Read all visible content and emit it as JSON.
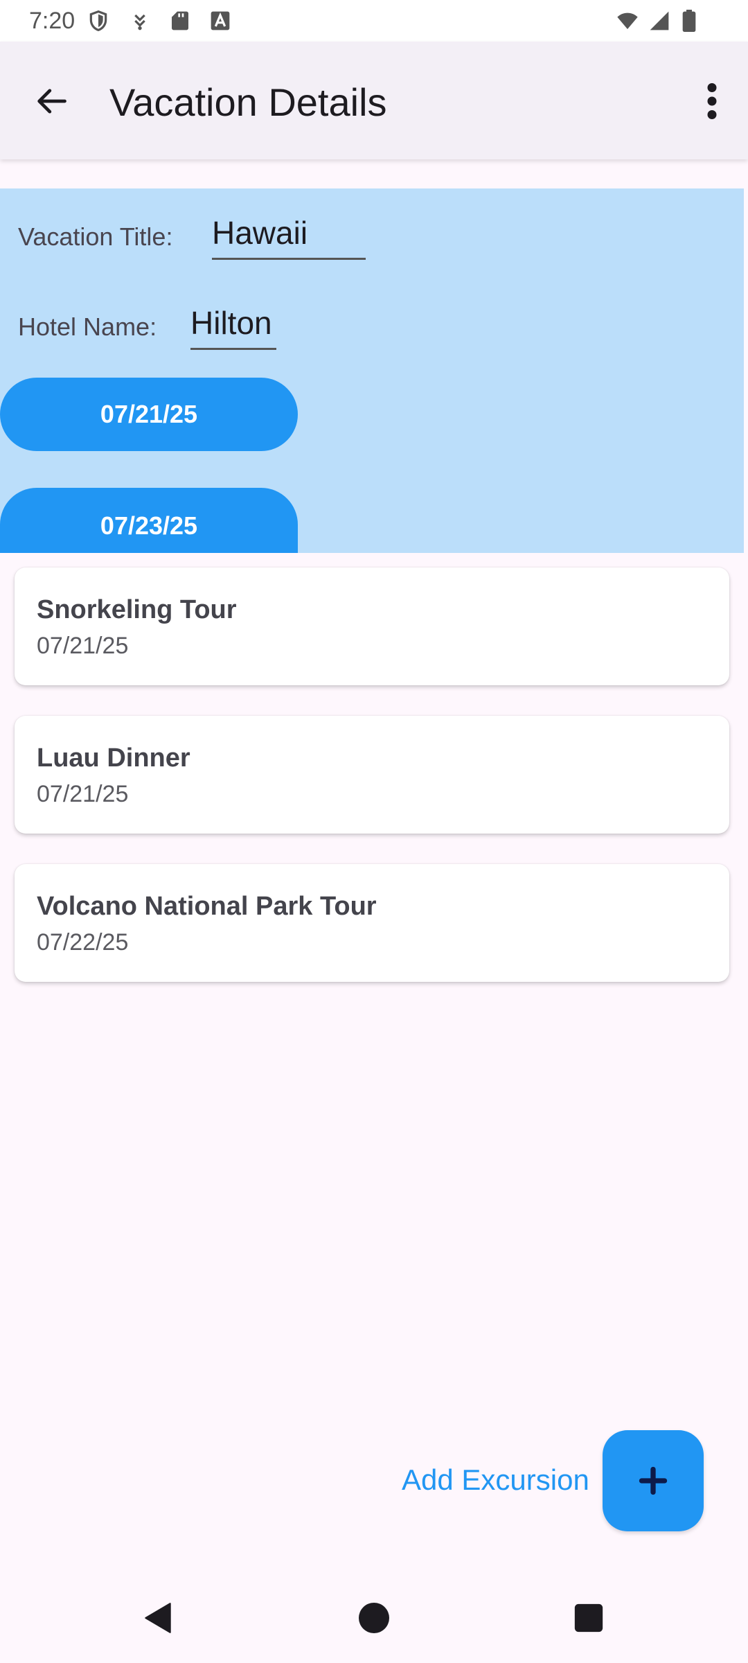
{
  "status_bar": {
    "time": "7:20",
    "icons": [
      "shield-icon",
      "usb-debug-icon",
      "sd-card-icon",
      "font-a-icon",
      "wifi-icon",
      "signal-icon",
      "battery-icon"
    ]
  },
  "app_bar": {
    "title": "Vacation Details",
    "back_icon": "arrow-back-icon",
    "menu_icon": "more-vert-icon"
  },
  "details": {
    "vacation_title_label": "Vacation Title:",
    "vacation_title_value": "Hawaii",
    "hotel_name_label": "Hotel Name:",
    "hotel_name_value": "Hilton",
    "start_date": "07/21/25",
    "end_date": "07/23/25"
  },
  "excursions": [
    {
      "title": "Snorkeling Tour",
      "date": "07/21/25"
    },
    {
      "title": "Luau Dinner",
      "date": "07/21/25"
    },
    {
      "title": "Volcano National Park Tour",
      "date": "07/22/25"
    }
  ],
  "add_excursion": {
    "label": "Add Excursion",
    "icon": "plus-icon"
  },
  "nav_bar": {
    "icons": [
      "nav-back-icon",
      "nav-home-icon",
      "nav-recents-icon"
    ]
  },
  "colors": {
    "accent": "#2196f3",
    "panel": "#bbdefa",
    "background": "#fef7fd",
    "app_bar": "#f3eff6"
  }
}
